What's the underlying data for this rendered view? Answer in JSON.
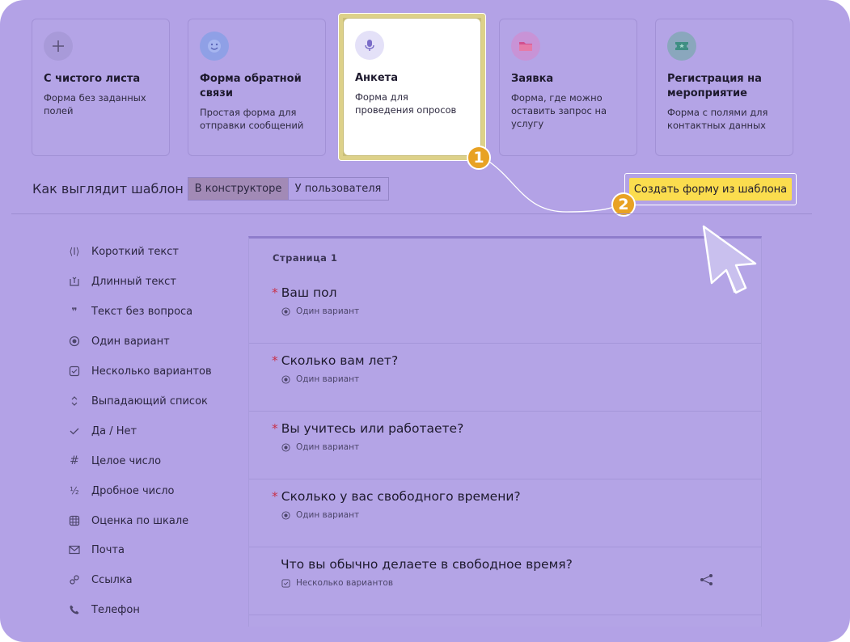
{
  "templates": [
    {
      "title": "С чистого листа",
      "desc": "Форма без заданных полей",
      "icon": "plus-icon",
      "icon_bg": "#a89ad9"
    },
    {
      "title": "Форма обратной связи",
      "desc": "Простая форма для отправки сообщений",
      "icon": "smile-icon",
      "icon_bg": "#8fa0e6"
    },
    {
      "title": "Анкета",
      "desc": "Форма для проведения опросов",
      "icon": "microphone-icon",
      "icon_bg": "#e4e1f8"
    },
    {
      "title": "Заявка",
      "desc": "Форма, где можно оставить запрос на услугу",
      "icon": "folder-icon",
      "icon_bg": "#c893d6"
    },
    {
      "title": "Регистрация на мероприятие",
      "desc": "Форма с полями для контактных данных",
      "icon": "ticket-icon",
      "icon_bg": "#8aa7bd"
    }
  ],
  "badges": {
    "one": "1",
    "two": "2"
  },
  "preview": {
    "label": "Как выглядит шаблон",
    "seg_constructor": "В конструкторе",
    "seg_user": "У пользователя",
    "create_button": "Создать форму из шаблона"
  },
  "sidebar": [
    {
      "label": "Короткий текст",
      "icon": "short-text-icon"
    },
    {
      "label": "Длинный текст",
      "icon": "long-text-icon"
    },
    {
      "label": "Текст без вопроса",
      "icon": "quote-icon"
    },
    {
      "label": "Один вариант",
      "icon": "radio-icon"
    },
    {
      "label": "Несколько вариантов",
      "icon": "checkbox-icon"
    },
    {
      "label": "Выпадающий список",
      "icon": "dropdown-icon"
    },
    {
      "label": "Да / Нет",
      "icon": "check-icon"
    },
    {
      "label": "Целое число",
      "icon": "hash-icon"
    },
    {
      "label": "Дробное число",
      "icon": "fraction-icon"
    },
    {
      "label": "Оценка по шкале",
      "icon": "grid-icon"
    },
    {
      "label": "Почта",
      "icon": "mail-icon"
    },
    {
      "label": "Ссылка",
      "icon": "link-icon"
    },
    {
      "label": "Телефон",
      "icon": "phone-icon"
    }
  ],
  "form": {
    "page_title": "Страница 1",
    "required_mark": "*",
    "questions": [
      {
        "title": "Ваш пол",
        "required": true,
        "type": "Один вариант"
      },
      {
        "title": "Сколько вам лет?",
        "required": true,
        "type": "Один вариант"
      },
      {
        "title": "Вы учитесь или работаете?",
        "required": true,
        "type": "Один вариант"
      },
      {
        "title": "Сколько у вас свободного времени?",
        "required": true,
        "type": "Один вариант"
      },
      {
        "title": "Что вы обычно делаете в свободное время?",
        "required": false,
        "type": "Несколько вариантов"
      }
    ]
  }
}
